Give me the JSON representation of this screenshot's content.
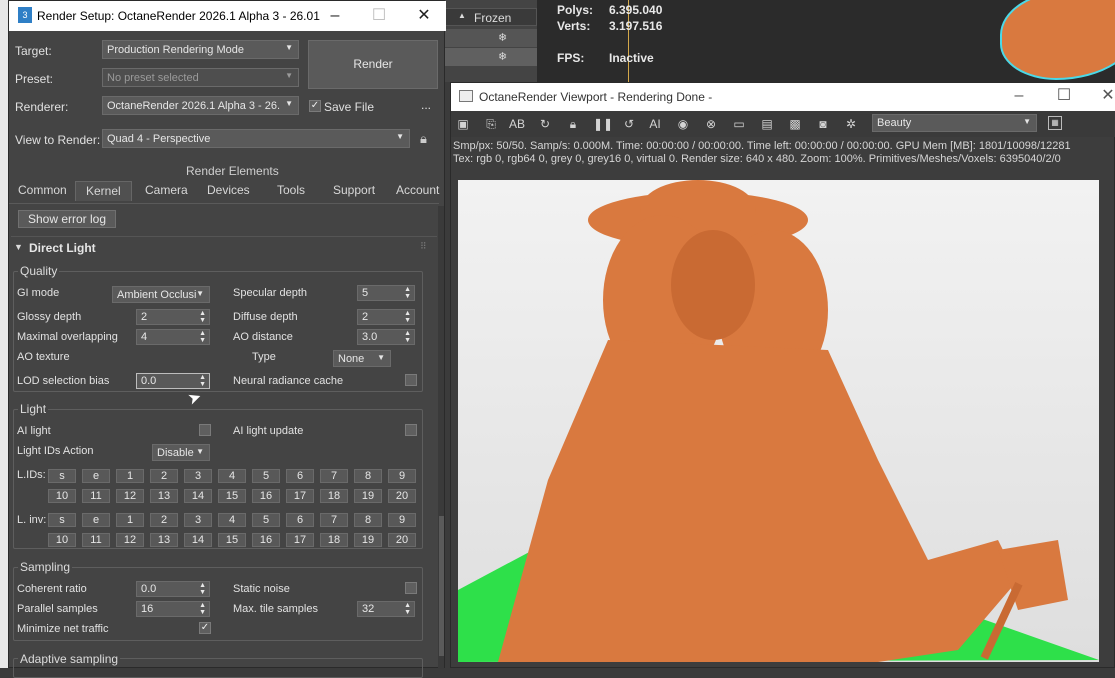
{
  "background": {
    "layer_label": "Frozen",
    "stats": [
      {
        "label": "Polys:",
        "value": "6.395.040"
      },
      {
        "label": "Verts:",
        "value": "3.197.516"
      },
      {
        "label": "FPS:",
        "value": "Inactive"
      }
    ]
  },
  "render_setup": {
    "title": "Render Setup: OctaneRender 2026.1 Alpha 3 - 26.01",
    "target_label": "Target:",
    "target_value": "Production Rendering Mode",
    "preset_label": "Preset:",
    "preset_value": "No preset selected",
    "renderer_label": "Renderer:",
    "renderer_value": "OctaneRender 2026.1 Alpha 3 - 26.",
    "save_file_label": "Save File",
    "save_file_checked": true,
    "view_label": "View to Render:",
    "view_value": "Quad 4 - Perspective",
    "render_button": "Render",
    "more": "...",
    "render_elements": "Render Elements",
    "tabs": [
      "Common",
      "Kernel",
      "Camera",
      "Devices",
      "Tools",
      "Support",
      "Account"
    ],
    "active_tab": "Kernel",
    "show_error_log": "Show error log",
    "rollout_title": "Direct Light",
    "quality": {
      "title": "Quality",
      "gi_mode_label": "GI mode",
      "gi_mode_value": "Ambient Occlusi",
      "specular_depth_label": "Specular depth",
      "specular_depth_value": "5",
      "glossy_depth_label": "Glossy depth",
      "glossy_depth_value": "2",
      "diffuse_depth_label": "Diffuse depth",
      "diffuse_depth_value": "2",
      "max_overlap_label": "Maximal overlapping",
      "max_overlap_value": "4",
      "ao_distance_label": "AO distance",
      "ao_distance_value": "3.0",
      "ao_texture_label": "AO texture",
      "type_label": "Type",
      "type_value": "None",
      "lod_label": "LOD selection bias",
      "lod_value": "0.0",
      "neural_label": "Neural radiance cache"
    },
    "light": {
      "title": "Light",
      "ai_light_label": "AI light",
      "ai_light_update_label": "AI light update",
      "ids_action_label": "Light IDs Action",
      "ids_action_value": "Disable",
      "lids_label": "L.IDs:",
      "linv_label": "L. inv:",
      "ids_row1": [
        "s",
        "e",
        "1",
        "2",
        "3",
        "4",
        "5",
        "6",
        "7",
        "8",
        "9"
      ],
      "ids_row2": [
        "10",
        "11",
        "12",
        "13",
        "14",
        "15",
        "16",
        "17",
        "18",
        "19",
        "20"
      ]
    },
    "sampling": {
      "title": "Sampling",
      "coherent_label": "Coherent ratio",
      "coherent_value": "0.0",
      "static_noise_label": "Static noise",
      "parallel_label": "Parallel samples",
      "parallel_value": "16",
      "max_tile_label": "Max. tile samples",
      "max_tile_value": "32",
      "min_net_label": "Minimize net traffic",
      "min_net_checked": true
    },
    "adaptive_title": "Adaptive sampling"
  },
  "viewport": {
    "title": "OctaneRender Viewport - Rendering Done -",
    "pass_value": "Beauty",
    "info_line1": "Smp/px: 50/50.   Samp/s: 0.000M.   Time: 00:00:00 / 00:00:00.   Time left: 00:00:00 / 00:00:00.   GPU Mem [MB]: 1801/10098/12281",
    "info_line2": "Tex: rgb 0, rgb64 0, grey 0, grey16 0, virtual 0.   Render size: 640 x 480.   Zoom: 100%.   Primitives/Meshes/Voxels: 6395040/2/0",
    "toolbar_icons": [
      "save-icon",
      "copy-icon",
      "ab-compare-icon",
      "refresh-icon",
      "lock-icon",
      "pause-icon",
      "restart-icon",
      "ai-icon",
      "color-icon",
      "stop-icon",
      "region-icon",
      "film-icon",
      "camera-icon",
      "record-icon",
      "settings-icon",
      "layers-icon"
    ]
  },
  "colors": {
    "statue": "#d9793f",
    "ground": "#2ee04a",
    "window_bg": "#444444"
  }
}
